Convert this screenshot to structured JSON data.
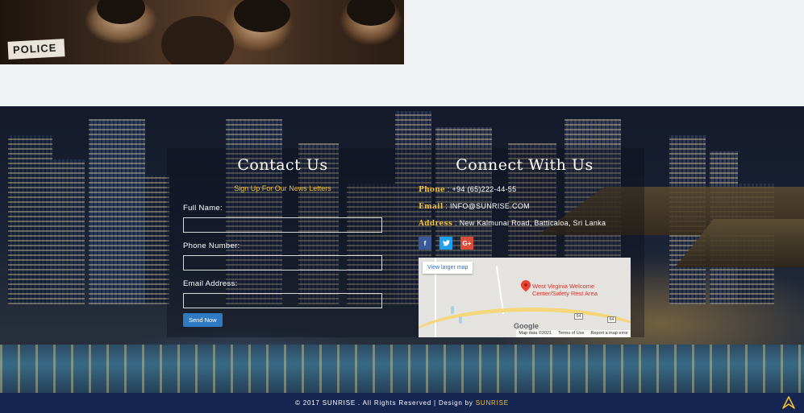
{
  "hero": {
    "police_label": "POLICE"
  },
  "contact": {
    "title": "Contact Us",
    "subtitle": "Sign Up For Our News Letters",
    "fields": [
      {
        "label": "Full Name:",
        "value": "",
        "placeholder": ""
      },
      {
        "label": "Phone Number:",
        "value": "",
        "placeholder": ""
      },
      {
        "label": "Email Address:",
        "value": "",
        "placeholder": ""
      }
    ],
    "send_label": "Send Now"
  },
  "connect": {
    "title": "Connect With Us",
    "phone_key": "Phone",
    "phone_value": ": +94 (65)222-44-55",
    "email_key": "Email",
    "email_value": ": INFO@SUNRISE.COM",
    "address_key": "Address",
    "address_value": ": New Kalmunai Road, Batticaloa, Sri Lanka",
    "social": [
      {
        "icon": "facebook-icon",
        "glyph": "f"
      },
      {
        "icon": "twitter-icon",
        "glyph": "t"
      },
      {
        "icon": "google-plus-icon",
        "glyph": "G+"
      }
    ]
  },
  "map": {
    "larger_map_link": "View larger map",
    "place_label": "West Virginia Welcome Center/Safety Rest Area",
    "shield_a": "64",
    "shield_b": "64",
    "google": "Google",
    "map_data": "Map data ©2021",
    "terms": "Terms of Use",
    "report": "Report a map error"
  },
  "footer": {
    "copyright": "© 2017 SUNRISE . All Rights Reserved | Design by ",
    "brand": "SUNRISE"
  },
  "colors": {
    "accent_yellow": "#f2c12e",
    "footer_navy": "#152653",
    "button_blue": "#2e7bc4"
  }
}
